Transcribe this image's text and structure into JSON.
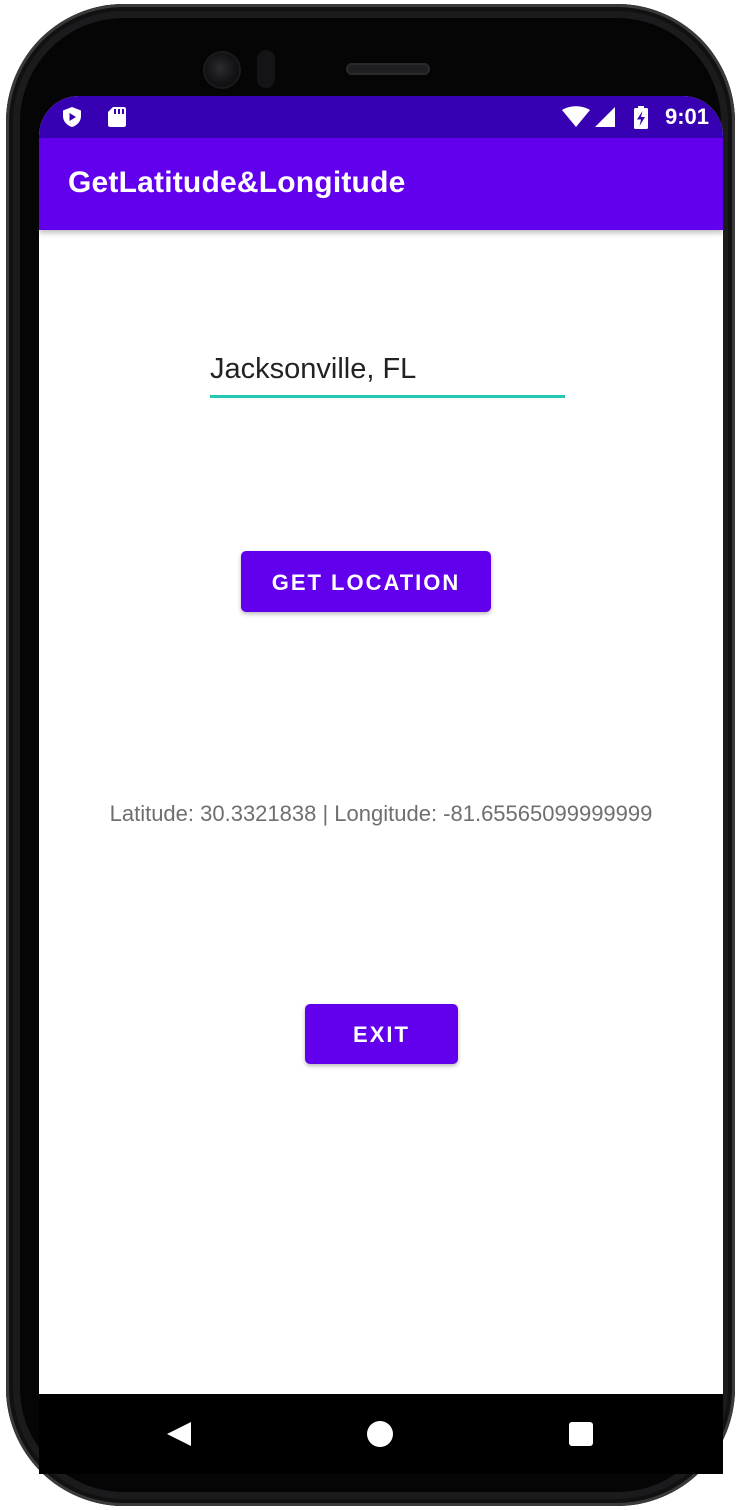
{
  "status_bar": {
    "time": "9:01",
    "icons": [
      "shield-play-icon",
      "sd-card-icon",
      "wifi-icon",
      "cell-signal-icon",
      "battery-charging-icon"
    ]
  },
  "app_bar": {
    "title": "GetLatitude&Longitude"
  },
  "location_input": {
    "value": "Jacksonville, FL",
    "placeholder": ""
  },
  "buttons": {
    "get_location": "GET LOCATION",
    "exit": "EXIT"
  },
  "result": {
    "text": "Latitude: 30.3321838 | Longitude: -81.65565099999999"
  },
  "navigation": {
    "icons": [
      "back-icon",
      "home-icon",
      "recents-icon"
    ]
  },
  "colors": {
    "status_bar": "#3700b3",
    "primary": "#6200ee",
    "accent_underline": "#26c6b5",
    "result_text": "#6f6f6f"
  }
}
